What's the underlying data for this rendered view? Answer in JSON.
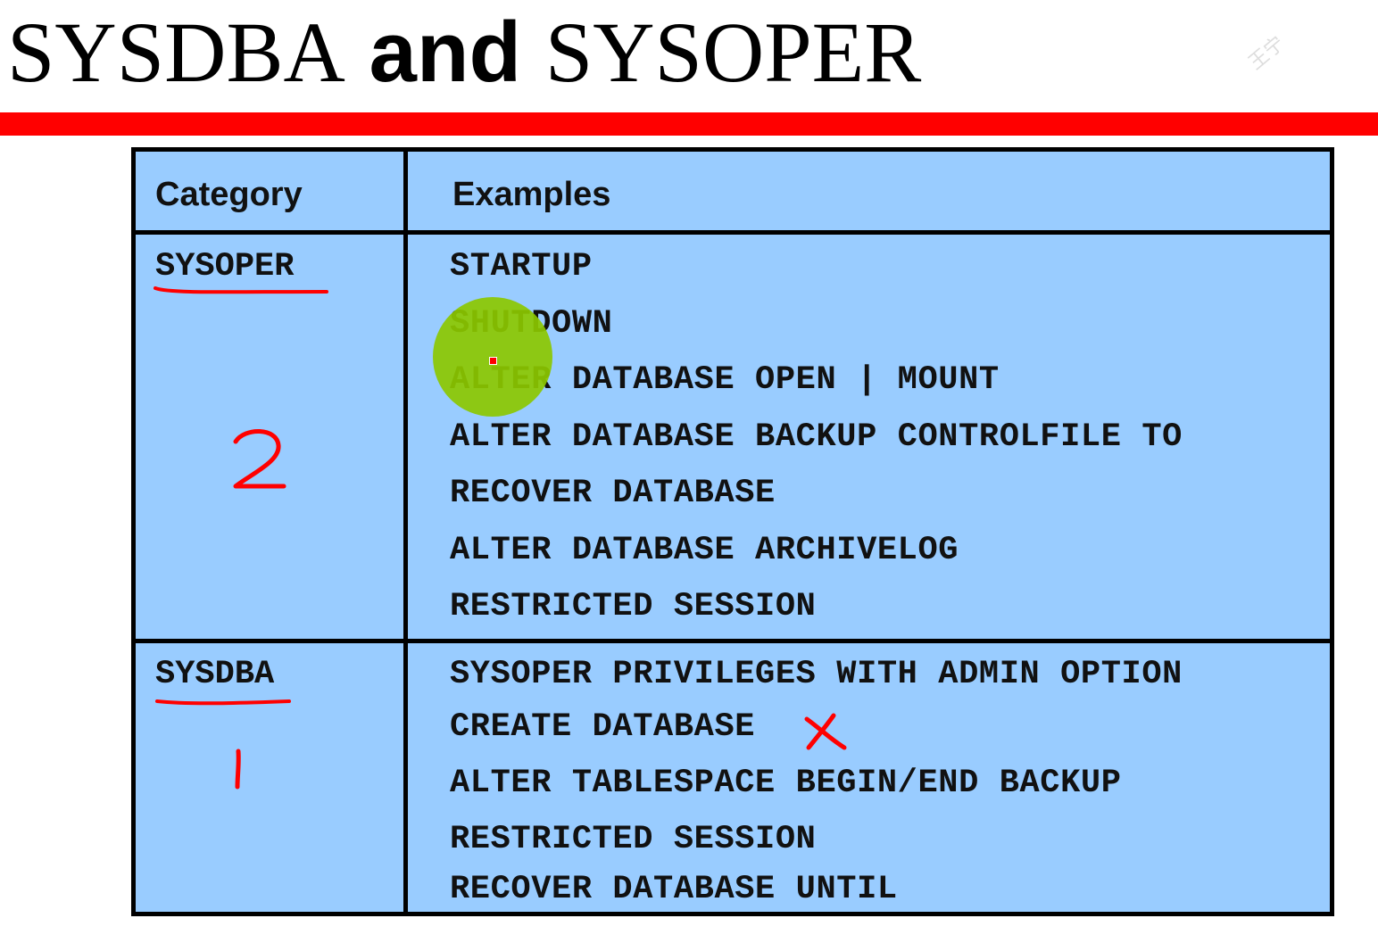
{
  "title": {
    "part1": "SYSDBA",
    "part2": "and",
    "part3": "SYSOPER"
  },
  "table": {
    "headers": {
      "category": "Category",
      "examples": "Examples"
    },
    "rows": [
      {
        "category": "SYSOPER",
        "annotation": "2",
        "examples": [
          "STARTUP",
          "SHUTDOWN",
          "ALTER DATABASE OPEN | MOUNT",
          "ALTER DATABASE BACKUP CONTROLFILE TO",
          "RECOVER DATABASE",
          "ALTER DATABASE ARCHIVELOG",
          "RESTRICTED SESSION"
        ]
      },
      {
        "category": "SYSDBA",
        "annotation": "1",
        "examples": [
          "SYSOPER PRIVILEGES WITH ADMIN OPTION",
          "CREATE DATABASE",
          "ALTER TABLESPACE BEGIN/END BACKUP",
          "RESTRICTED SESSION",
          "RECOVER DATABASE UNTIL"
        ]
      }
    ]
  },
  "colors": {
    "rule": "#ff0000",
    "table_bg": "#99ccff",
    "ink": "#ff0000",
    "cursor": "#8cc800"
  },
  "watermark": "王宁"
}
